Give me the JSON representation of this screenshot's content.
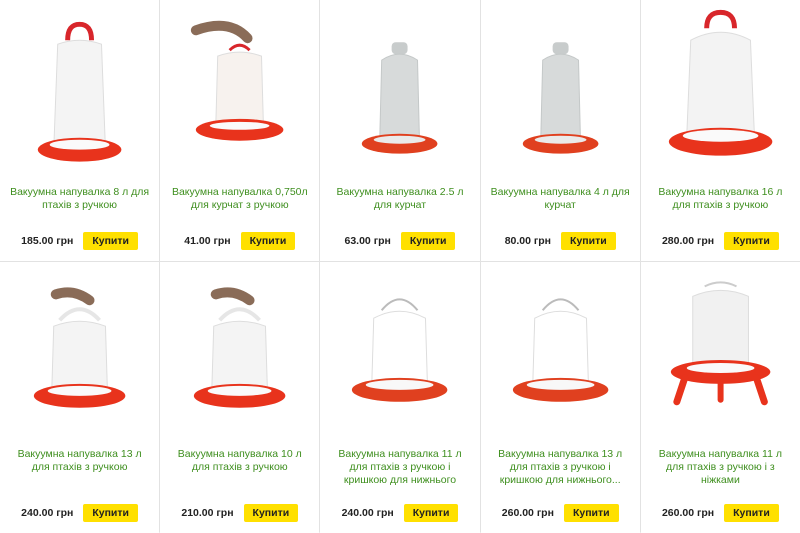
{
  "currency": "грн",
  "buy_label": "Купити",
  "products": [
    {
      "title": "Вакуумна напувалка 8 л для птахів з ручкою",
      "price": "185.00 грн",
      "icon": "red-handle-feeder",
      "row": 1
    },
    {
      "title": "Вакуумна напувалка 0,750л для курчат з ручкою",
      "price": "41.00 грн",
      "icon": "hand-held-feeder",
      "row": 1
    },
    {
      "title": "Вакуумна напувалка 2.5 л для курчат",
      "price": "63.00 грн",
      "icon": "grey-feeder",
      "row": 1
    },
    {
      "title": "Вакуумна напувалка 4 л для курчат",
      "price": "80.00 грн",
      "icon": "grey-feeder",
      "row": 1
    },
    {
      "title": "Вакуумна напувалка 16 л для птахів з ручкою",
      "price": "280.00 грн",
      "icon": "red-handle-feeder-large",
      "row": 1
    },
    {
      "title": "Вакуумна напувалка 13 л для птахів з ручкою",
      "price": "240.00 грн",
      "icon": "hand-held-feeder",
      "row": 2
    },
    {
      "title": "Вакуумна напувалка 10 л для птахів з ручкою",
      "price": "210.00 грн",
      "icon": "hand-held-feeder",
      "row": 2
    },
    {
      "title": "Вакуумна напувалка 11 л для птахів з ручкою і кришкою для нижнього заповнення",
      "price": "240.00 грн",
      "icon": "wire-handle-feeder",
      "row": 2
    },
    {
      "title": "Вакуумна напувалка 13 л для птахів з ручкою і кришкою для нижнього...",
      "price": "260.00 грн",
      "icon": "wire-handle-feeder",
      "row": 2
    },
    {
      "title": "Вакуумна напувалка 11 л для птахів з ручкою і з ніжками",
      "price": "260.00 грн",
      "icon": "legged-feeder",
      "row": 2
    }
  ],
  "colors": {
    "title": "#3f8f1f",
    "button": "#ffe000",
    "tray": "#e8331c"
  }
}
